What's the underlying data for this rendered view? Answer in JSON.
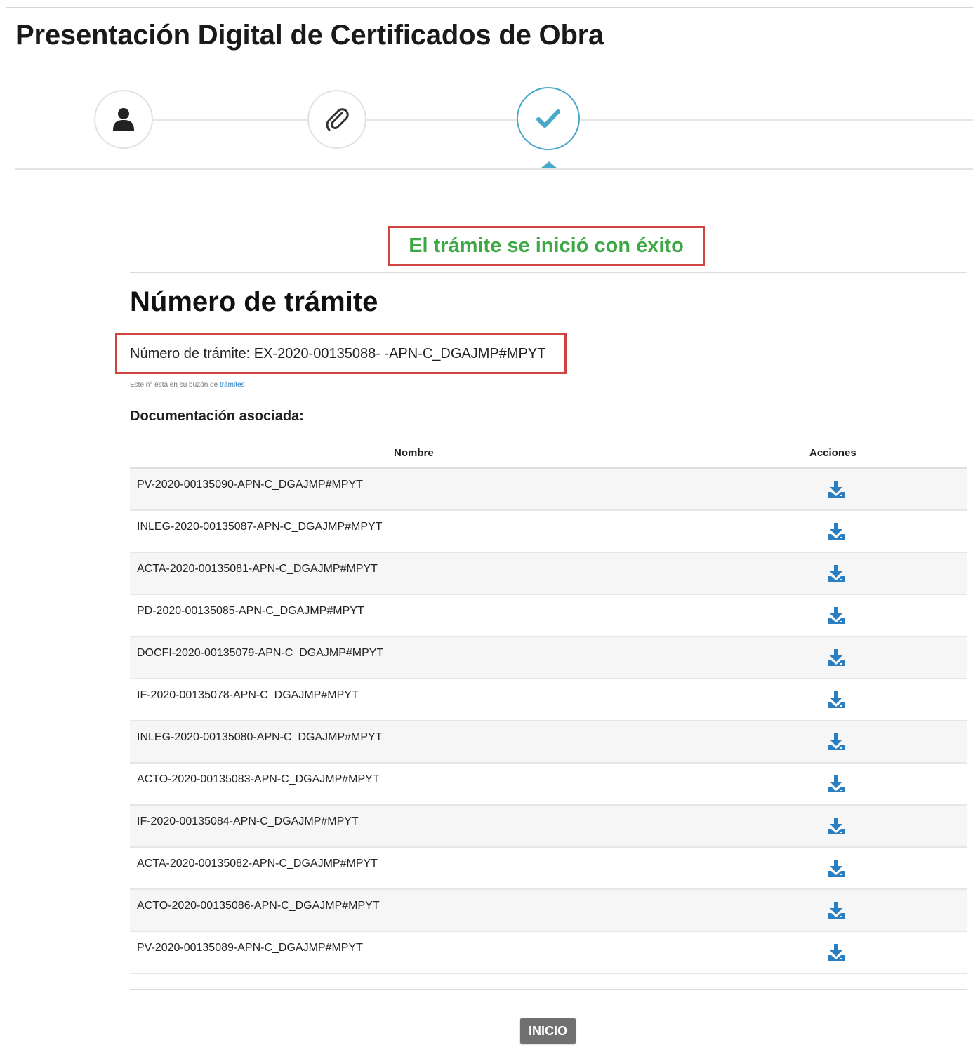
{
  "header": {
    "title": "Presentación Digital de Certificados de Obra"
  },
  "stepper": {
    "steps": [
      {
        "icon": "user-icon",
        "state": "done"
      },
      {
        "icon": "paperclip-icon",
        "state": "done"
      },
      {
        "icon": "check-icon",
        "state": "active"
      }
    ],
    "accent": "#4aa8c8"
  },
  "success": {
    "message": "El trámite se inició con éxito",
    "color": "#3fa846"
  },
  "tramite": {
    "heading": "Número de trámite",
    "number_line": "Número de trámite: EX-2020-00135088- -APN-C_DGAJMP#MPYT",
    "note_prefix": "Este n° está en su buzón de ",
    "note_link": "trámites"
  },
  "documents": {
    "heading": "Documentación asociada:",
    "columns": {
      "name": "Nombre",
      "actions": "Acciones"
    },
    "rows": [
      "PV-2020-00135090-APN-C_DGAJMP#MPYT",
      "INLEG-2020-00135087-APN-C_DGAJMP#MPYT",
      "ACTA-2020-00135081-APN-C_DGAJMP#MPYT",
      "PD-2020-00135085-APN-C_DGAJMP#MPYT",
      "DOCFI-2020-00135079-APN-C_DGAJMP#MPYT",
      "IF-2020-00135078-APN-C_DGAJMP#MPYT",
      "INLEG-2020-00135080-APN-C_DGAJMP#MPYT",
      "ACTO-2020-00135083-APN-C_DGAJMP#MPYT",
      "IF-2020-00135084-APN-C_DGAJMP#MPYT",
      "ACTA-2020-00135082-APN-C_DGAJMP#MPYT",
      "ACTO-2020-00135086-APN-C_DGAJMP#MPYT",
      "PV-2020-00135089-APN-C_DGAJMP#MPYT"
    ],
    "action_icon": "download-icon",
    "icon_color": "#2a7ec2"
  },
  "footer": {
    "button_label": "INICIO"
  }
}
